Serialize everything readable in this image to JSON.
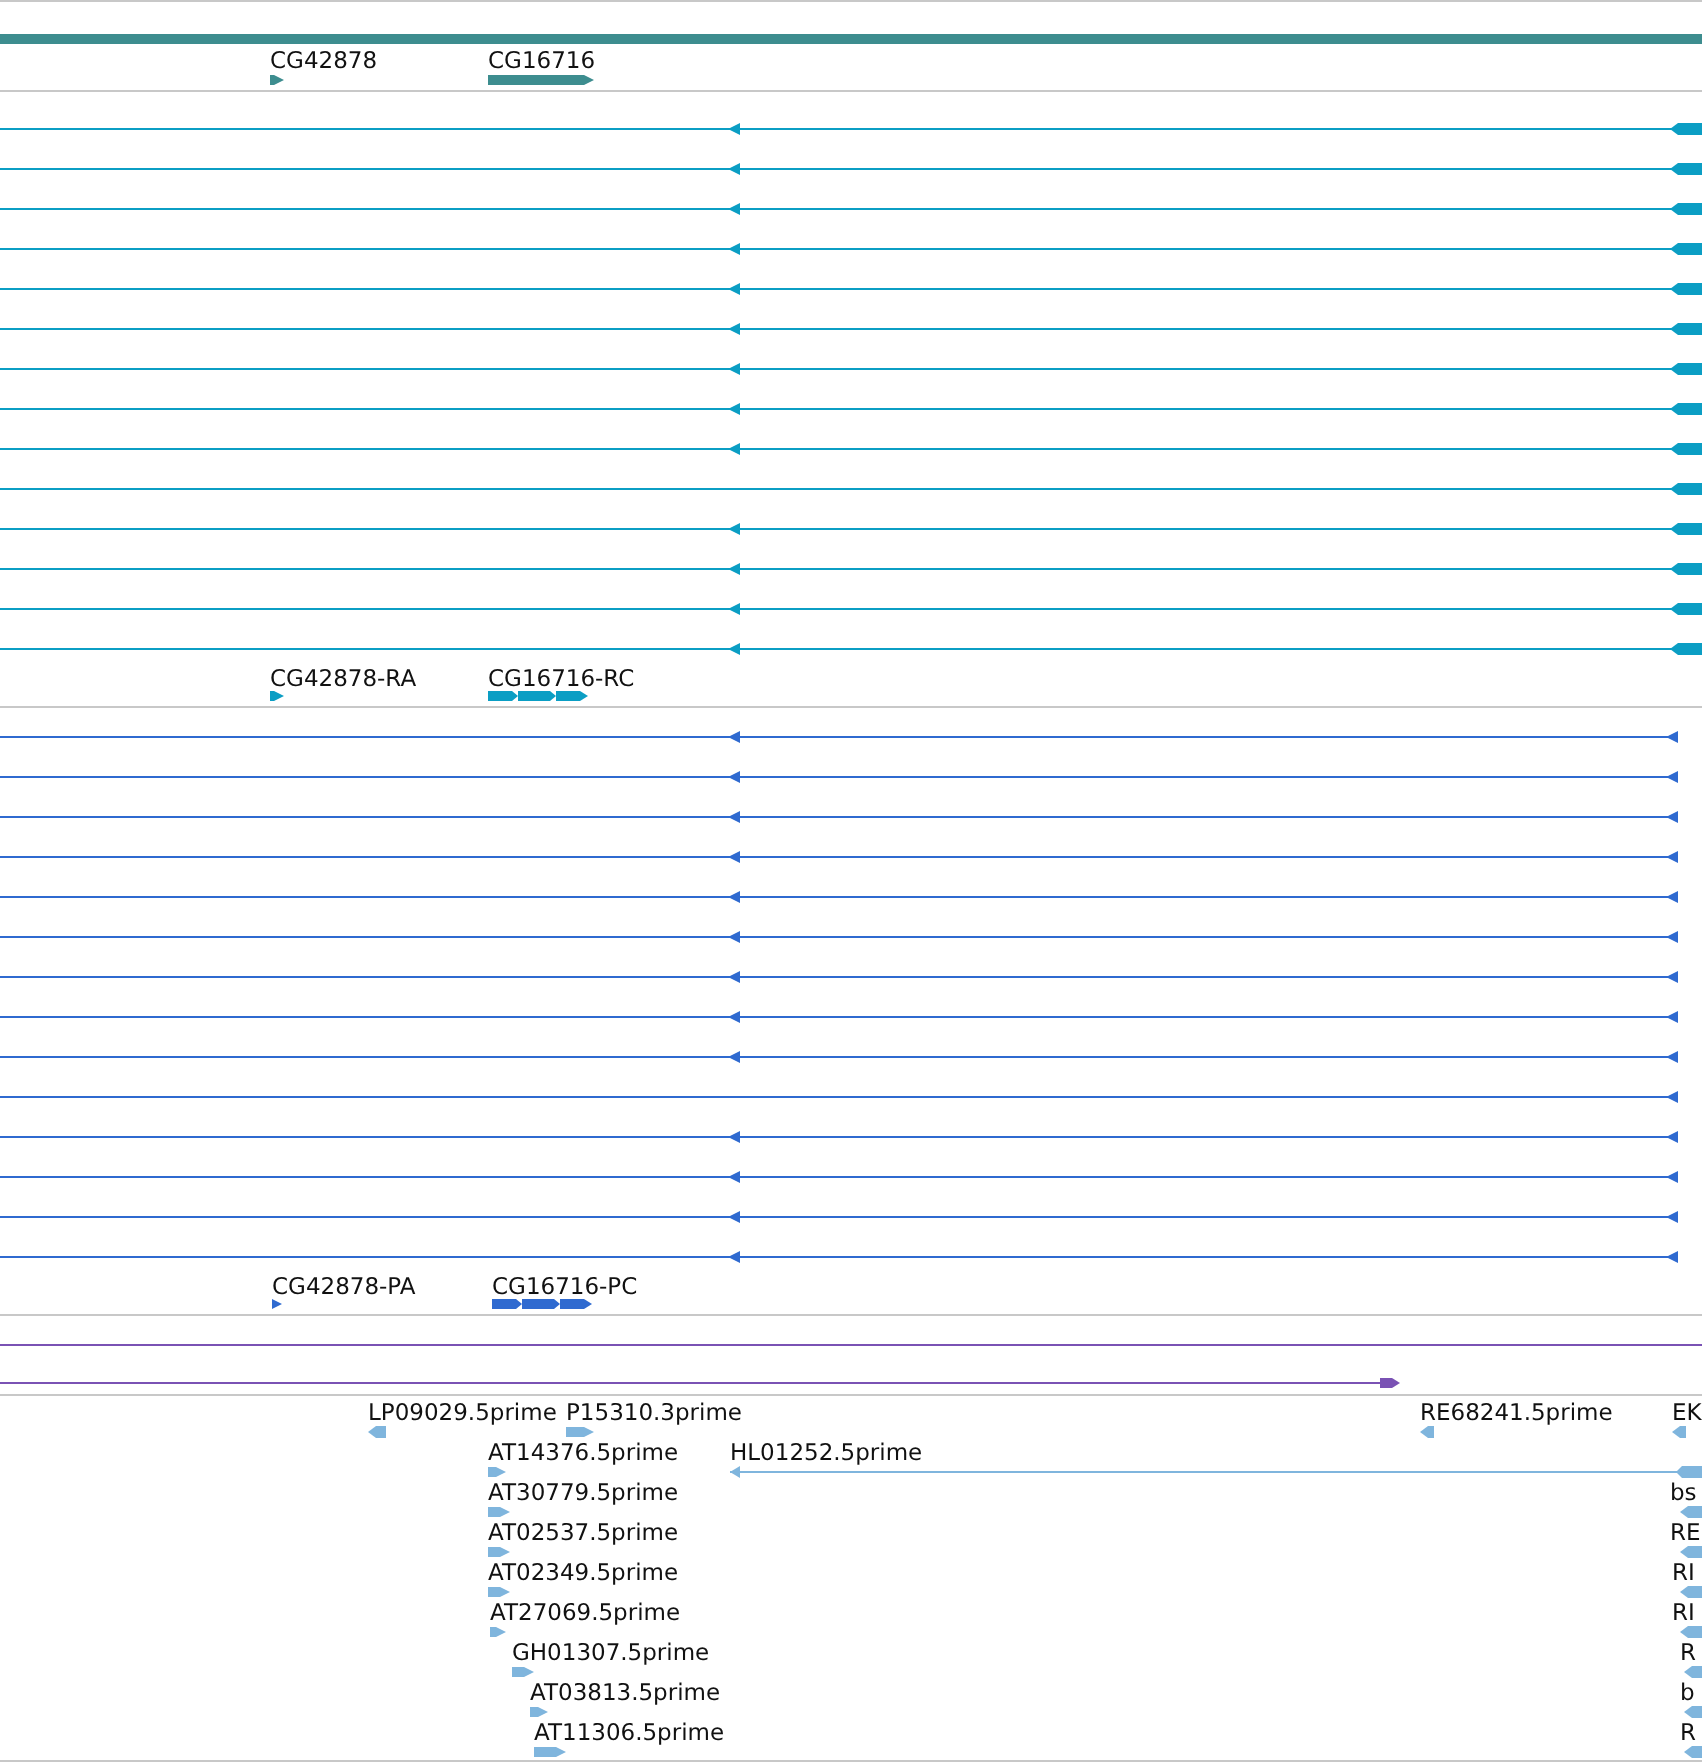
{
  "tracks": [
    {
      "kind": "gene",
      "features": [
        {
          "label": "CG42878"
        },
        {
          "label": "CG16716"
        }
      ]
    },
    {
      "kind": "transcript",
      "rows": [
        {
          "marker": true
        },
        {
          "marker": true
        },
        {
          "marker": true
        },
        {
          "marker": true
        },
        {
          "marker": true
        },
        {
          "marker": true
        },
        {
          "marker": true
        },
        {
          "marker": true
        },
        {
          "marker": true
        },
        {
          "marker": false
        },
        {
          "marker": true
        },
        {
          "marker": true
        },
        {
          "marker": true
        },
        {
          "marker": true
        }
      ],
      "features": [
        {
          "label": "CG42878-RA"
        },
        {
          "label": "CG16716-RC"
        }
      ]
    },
    {
      "kind": "protein",
      "rows": [
        {
          "marker": true
        },
        {
          "marker": true
        },
        {
          "marker": true
        },
        {
          "marker": true
        },
        {
          "marker": true
        },
        {
          "marker": true
        },
        {
          "marker": true
        },
        {
          "marker": true
        },
        {
          "marker": true
        },
        {
          "marker": false
        },
        {
          "marker": true
        },
        {
          "marker": true
        },
        {
          "marker": true
        },
        {
          "marker": true
        }
      ],
      "features": [
        {
          "label": "CG42878-PA"
        },
        {
          "label": "CG16716-PC"
        }
      ]
    },
    {
      "kind": "alignment"
    },
    {
      "kind": "est",
      "features": [
        {
          "label": "LP09029.5prime"
        },
        {
          "label": "P15310.3prime"
        },
        {
          "label": "RE68241.5prime"
        },
        {
          "label": "EK"
        },
        {
          "label": "AT14376.5prime"
        },
        {
          "label": "HL01252.5prime"
        },
        {
          "label": "AT30779.5prime"
        },
        {
          "label": "bs"
        },
        {
          "label": "AT02537.5prime"
        },
        {
          "label": "RE"
        },
        {
          "label": "AT02349.5prime"
        },
        {
          "label": "RI"
        },
        {
          "label": "AT27069.5prime"
        },
        {
          "label": "RI"
        },
        {
          "label": "GH01307.5prime"
        },
        {
          "label": "R"
        },
        {
          "label": "AT03813.5prime"
        },
        {
          "label": "b"
        },
        {
          "label": "AT11306.5prime"
        },
        {
          "label": "R"
        }
      ]
    }
  ]
}
